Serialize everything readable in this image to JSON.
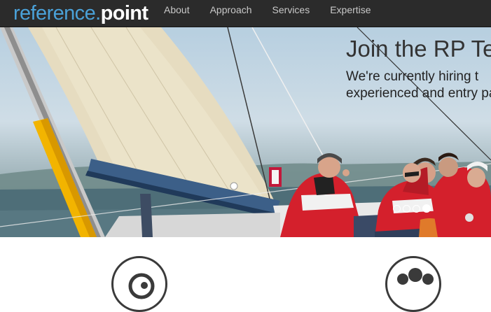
{
  "brand": {
    "part1": "reference",
    "dot": ".",
    "part2": "point"
  },
  "nav": {
    "items": [
      {
        "label": "About"
      },
      {
        "label": "Approach"
      },
      {
        "label": "Services"
      },
      {
        "label": "Expertise"
      }
    ]
  },
  "hero": {
    "title": "Join the RP Te",
    "body": "We're currently hiring t experienced and entry page.",
    "carousel": {
      "slide_count": 4,
      "active_index": 3
    }
  },
  "features": {
    "icons": [
      "target-icon",
      "team-icon"
    ]
  },
  "colors": {
    "navbar": "#2b2b2b",
    "logo_accent": "#4aa1d8",
    "nav_text": "#c8c8c8",
    "hero_text": "#222222",
    "sail": "#e6dcc0",
    "jacket_red": "#d4202c"
  }
}
